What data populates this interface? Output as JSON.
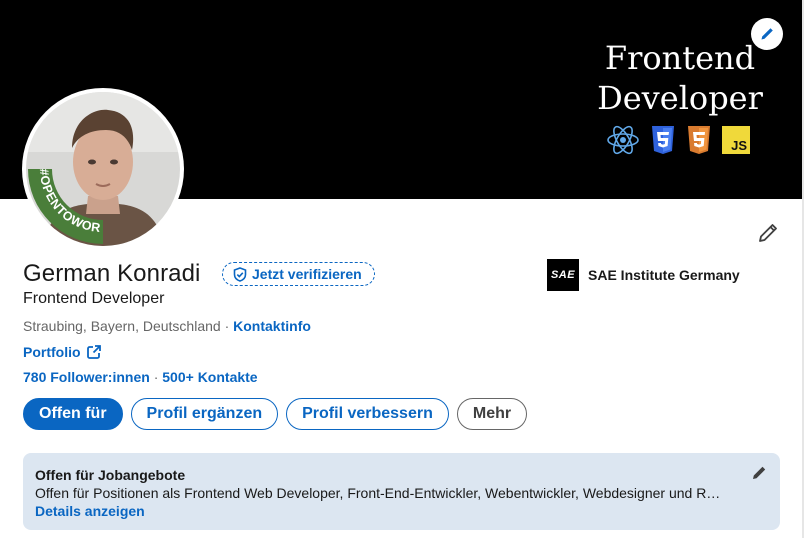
{
  "banner": {
    "line1": "Frontend",
    "line2": "Developer",
    "icons": [
      "react-icon",
      "css3-icon",
      "html5-icon",
      "javascript-icon"
    ],
    "js_label": "JS",
    "background_color": "#000000"
  },
  "profile": {
    "name": "German Konradi",
    "verify_label": "Jetzt verifizieren",
    "headline": "Frontend Developer",
    "location": "Straubing, Bayern, Deutschland",
    "location_separator": " · ",
    "contact_info": "Kontaktinfo",
    "portfolio_label": "Portfolio",
    "followers": "780 Follower:innen",
    "stats_separator": " · ",
    "connections": "500+ Kontakte",
    "open_to_work_badge": "#OPENTOWORK",
    "badge_color": "#4a7e3a"
  },
  "organization": {
    "logo_text": "SAE",
    "name": "SAE Institute Germany"
  },
  "actions": {
    "open_for": "Offen für",
    "add_section": "Profil ergänzen",
    "enhance": "Profil verbessern",
    "more": "Mehr"
  },
  "open_to_work": {
    "title": "Offen für Jobangebote",
    "description": "Offen für Positionen als Frontend Web Developer, Front-End-Entwickler, Webentwickler, Webdesigner und R…",
    "details_link": "Details anzeigen"
  },
  "colors": {
    "accent": "#0a66c2",
    "card_bg": "#dce6f1",
    "muted_text": "#666666"
  }
}
